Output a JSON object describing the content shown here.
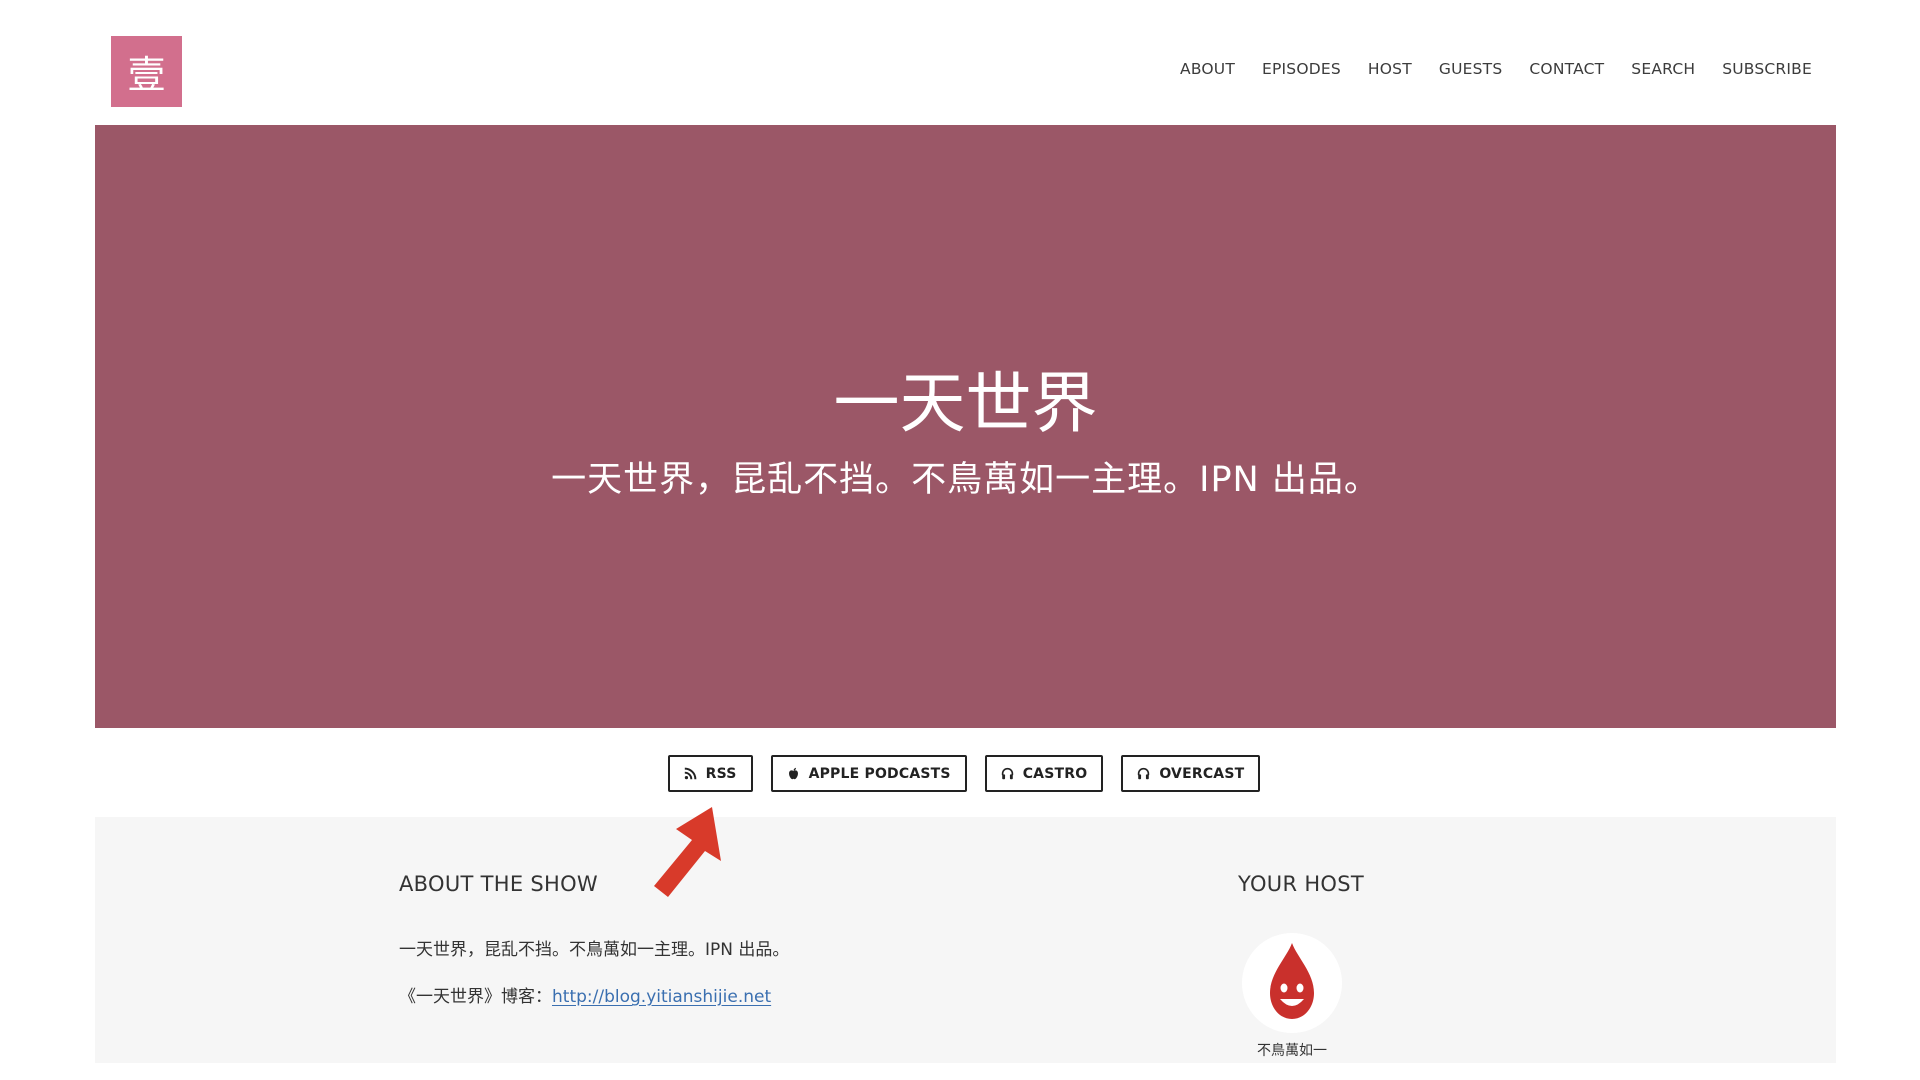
{
  "header": {
    "logo_text": "壹",
    "nav": [
      {
        "label": "ABOUT"
      },
      {
        "label": "EPISODES"
      },
      {
        "label": "HOST"
      },
      {
        "label": "GUESTS"
      },
      {
        "label": "CONTACT"
      },
      {
        "label": "SEARCH"
      },
      {
        "label": "SUBSCRIBE"
      }
    ]
  },
  "hero": {
    "title": "一天世界",
    "subtitle": "一天世界，昆乱不挡。不鳥萬如一主理。IPN 出品。",
    "background_color": "#9b5767"
  },
  "subscribe": {
    "buttons": [
      {
        "label": "RSS",
        "icon": "rss-icon"
      },
      {
        "label": "APPLE PODCASTS",
        "icon": "apple-icon"
      },
      {
        "label": "CASTRO",
        "icon": "headphones-icon"
      },
      {
        "label": "OVERCAST",
        "icon": "headphones-icon"
      }
    ]
  },
  "about": {
    "heading": "ABOUT THE SHOW",
    "description": "一天世界，昆乱不挡。不鳥萬如一主理。IPN 出品。",
    "blog_label": "《一天世界》博客：",
    "blog_url": "http://blog.yitianshijie.net"
  },
  "host": {
    "heading": "YOUR HOST",
    "name": "不鳥萬如一",
    "avatar_icon": "red-drop-mascot-icon"
  },
  "colors": {
    "logo_bg": "#d26f8d",
    "hero_bg": "#9b5767",
    "link": "#3a6fb0",
    "annotation_arrow": "#d83a2a"
  }
}
